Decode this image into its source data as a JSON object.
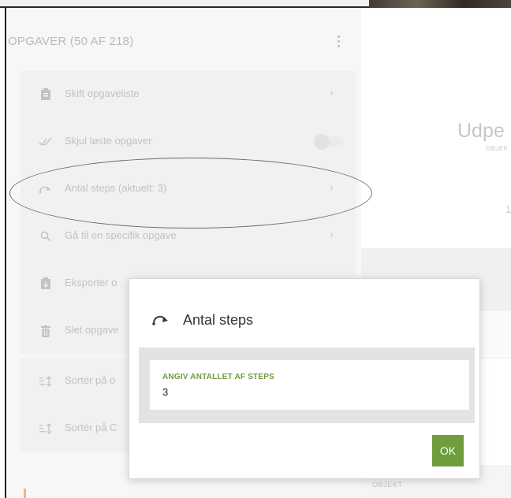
{
  "sidebar": {
    "title": "OPGAVER (50 AF 218)",
    "items": [
      {
        "label": "Skift opgaveliste",
        "icon": "clipboard-icon"
      },
      {
        "label": "Skjul løste opgaver",
        "icon": "double-check-icon",
        "toggle": false
      },
      {
        "label": "Antal steps (aktuelt: 3)",
        "icon": "steps-arrow-icon"
      },
      {
        "label": "Gå til en specifik opgave",
        "icon": "search-icon"
      },
      {
        "label": "Eksporter o",
        "icon": "export-icon"
      },
      {
        "label": "Slet opgave",
        "icon": "trash-icon"
      },
      {
        "label": "Sortér på o",
        "icon": "sort-icon"
      },
      {
        "label": "Sortér på C",
        "icon": "sort-icon"
      }
    ]
  },
  "main": {
    "title": "Udpe",
    "subtitle": "OBJEK",
    "number": "1",
    "section_label": "OBJEKT"
  },
  "dialog": {
    "title": "Antal steps",
    "field_label": "ANGIV ANTALLET AF STEPS",
    "field_value": "3",
    "ok_label": "OK"
  },
  "colors": {
    "accent_green": "#6f9c3c",
    "label_green": "#6e9b3d",
    "muted_text": "#c2c2c2"
  }
}
